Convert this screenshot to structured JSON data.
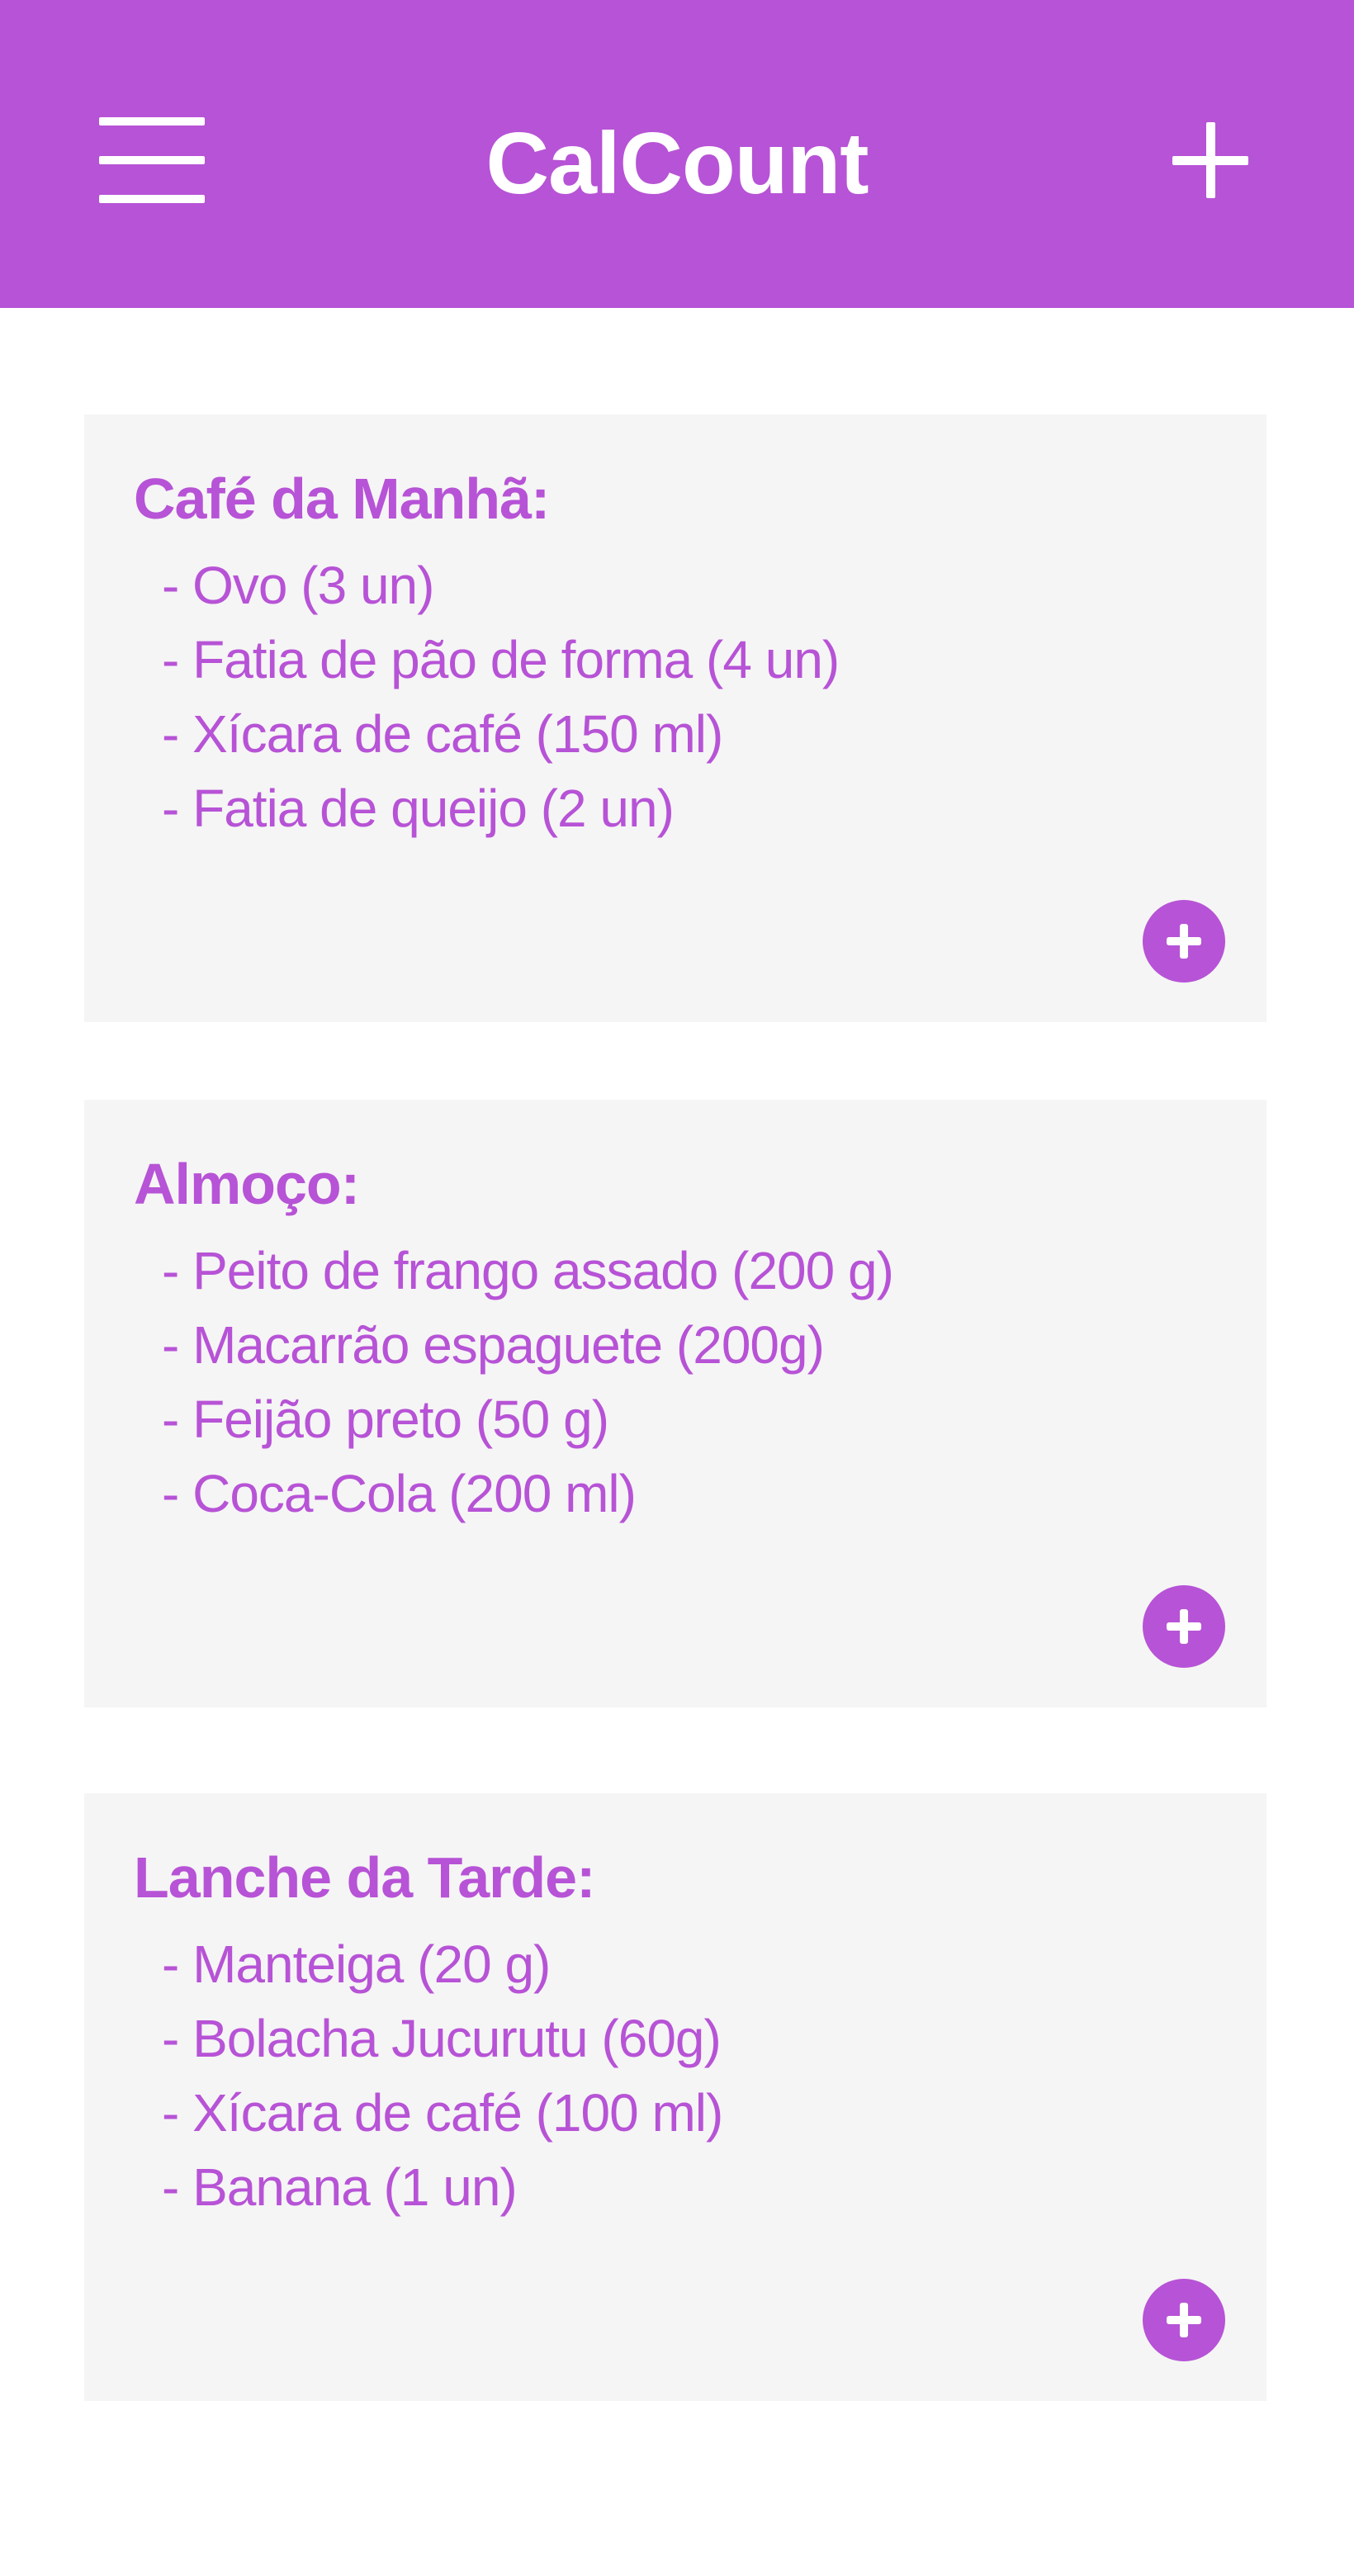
{
  "app": {
    "title": "CalCount",
    "accent_color": "#b753d6",
    "card_background": "#f5f5f5",
    "header_icons": [
      "menu-icon",
      "plus-icon"
    ]
  },
  "meals": [
    {
      "title": "Café da Manhã:",
      "items": [
        "- Ovo (3 un)",
        "- Fatia de pão de forma (4 un)",
        "- Xícara de café (150 ml)",
        "- Fatia de queijo (2 un)"
      ]
    },
    {
      "title": "Almoço:",
      "items": [
        "- Peito de frango assado (200 g)",
        "- Macarrão espaguete (200g)",
        "- Feijão preto (50 g)",
        "- Coca-Cola (200 ml)"
      ]
    },
    {
      "title": "Lanche da Tarde:",
      "items": [
        "- Manteiga (20 g)",
        "- Bolacha Jucurutu (60g)",
        "- Xícara de café (100 ml)",
        "- Banana (1 un)"
      ]
    }
  ]
}
